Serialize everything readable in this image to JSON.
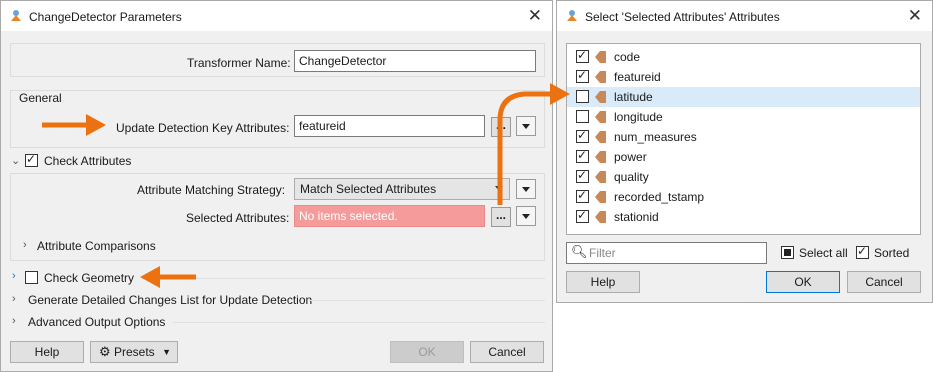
{
  "left_dialog": {
    "title": "ChangeDetector Parameters",
    "transformer_name_label": "Transformer Name:",
    "transformer_name_value": "ChangeDetector",
    "general_section": "General",
    "update_key_label": "Update Detection Key Attributes:",
    "update_key_value": "featureid",
    "check_attributes_label": "Check Attributes",
    "matching_strategy_label": "Attribute Matching Strategy:",
    "matching_strategy_value": "Match Selected Attributes",
    "selected_attributes_label": "Selected Attributes:",
    "selected_attributes_placeholder": "No items selected.",
    "attribute_comparisons_label": "Attribute Comparisons",
    "check_geometry_label": "Check Geometry",
    "changes_list_label": "Generate Detailed Changes List for Update Detection",
    "advanced_output_label": "Advanced Output Options",
    "help_label": "Help",
    "presets_label": "Presets",
    "ok_label": "OK",
    "cancel_label": "Cancel",
    "ellipsis_label": "..."
  },
  "right_dialog": {
    "title": "Select 'Selected Attributes' Attributes",
    "attributes": [
      {
        "name": "code",
        "checked": true
      },
      {
        "name": "featureid",
        "checked": true
      },
      {
        "name": "latitude",
        "checked": false
      },
      {
        "name": "longitude",
        "checked": false
      },
      {
        "name": "num_measures",
        "checked": true
      },
      {
        "name": "power",
        "checked": true
      },
      {
        "name": "quality",
        "checked": true
      },
      {
        "name": "recorded_tstamp",
        "checked": true
      },
      {
        "name": "stationid",
        "checked": true
      }
    ],
    "filter_placeholder": "Filter",
    "select_all_label": "Select all",
    "sorted_label": "Sorted",
    "help_label": "Help",
    "ok_label": "OK",
    "cancel_label": "Cancel"
  },
  "colors": {
    "annotation_arrow": "#ec7211",
    "attribute_icon": "#c8895a",
    "highlight_row": "#d9ebf9",
    "error_field": "#f59b9b"
  }
}
